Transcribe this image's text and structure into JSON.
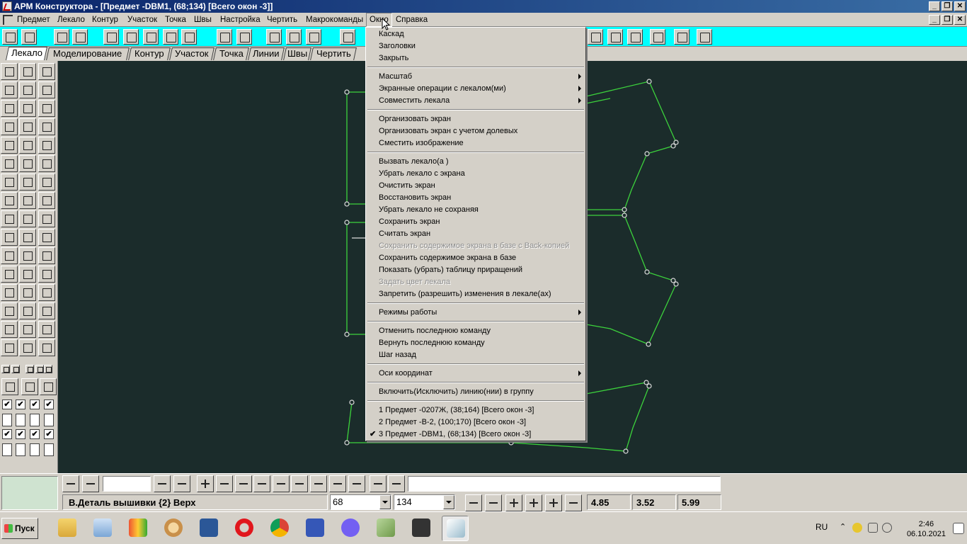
{
  "window": {
    "title": "АРМ Конструктора - [Предмет -DBM1,  (68;134) [Всего окон -3]]"
  },
  "menubar": {
    "items": [
      "Предмет",
      "Лекало",
      "Контур",
      "Участок",
      "Точка",
      "Швы",
      "Настройка",
      "Чертить",
      "Макрокоманды",
      "Окно",
      "Справка"
    ],
    "active": "Окно"
  },
  "tabs": [
    "Лекало",
    "Моделирование",
    "Контур",
    "Участок",
    "Точка",
    "Линии",
    "Швы",
    "Чертить"
  ],
  "active_tab": "Лекало",
  "window_menu": {
    "items": [
      {
        "label": "Каскад"
      },
      {
        "label": "Заголовки"
      },
      {
        "label": "Закрыть"
      },
      {
        "sep": true
      },
      {
        "label": "Масштаб",
        "submenu": true
      },
      {
        "label": "Экранные операции с лекалом(ми)",
        "submenu": true
      },
      {
        "label": "Совместить лекала",
        "submenu": true
      },
      {
        "sep": true
      },
      {
        "label": "Организовать  экран"
      },
      {
        "label": "Организовать экран с учетом долевых"
      },
      {
        "label": "Сместить изображение"
      },
      {
        "sep": true
      },
      {
        "label": "Вызвать лекало(а )"
      },
      {
        "label": "Убрать лекало с экрана"
      },
      {
        "label": "Очистить экран"
      },
      {
        "label": "Восстановить экран"
      },
      {
        "label": "Убрать лекало не сохраняя"
      },
      {
        "label": "Сохранить  экран"
      },
      {
        "label": "Считать экран"
      },
      {
        "label": "Сохранить содержимое экрана в базе с  Back-копией",
        "disabled": true
      },
      {
        "label": "Сохранить содержимое экрана в базе"
      },
      {
        "label": "Показать (убрать) таблицу приращений"
      },
      {
        "label": "Задать цвет лекала",
        "disabled": true
      },
      {
        "label": "Запретить (разрешить) изменения в лекале(ах)"
      },
      {
        "sep": true
      },
      {
        "label": "Режимы работы",
        "submenu": true
      },
      {
        "sep": true
      },
      {
        "label": "Отменить последнюю команду"
      },
      {
        "label": "Вернуть последнюю команду"
      },
      {
        "label": "Шаг назад"
      },
      {
        "sep": true
      },
      {
        "label": "Оси координат",
        "submenu": true
      },
      {
        "sep": true
      },
      {
        "label": "Включить(Исключить) линию(нии) в группу"
      },
      {
        "sep": true
      },
      {
        "label": "1 Предмет -0207Ж,  (38;164) [Всего окон -3]"
      },
      {
        "label": "2 Предмет -В-2,  (100;170) [Всего окон -3]"
      },
      {
        "label": "3 Предмет -DBM1,  (68;134) [Всего окон -3]",
        "checked": true
      }
    ]
  },
  "status": {
    "detail": "В.Деталь вышивки {2} Верх",
    "x_value": "68",
    "y_value": "134",
    "num1": "4.85",
    "num2": "3.52",
    "num3": "5.99"
  },
  "taskbar": {
    "start_label": "Пуск",
    "lang": "RU",
    "time": "2:46",
    "date": "06.10.2021"
  },
  "colors": {
    "canvas": "#1b2c2b",
    "pattern_line": "#3cd23c",
    "toolbar": "#00ffff",
    "title_start": "#0a246a"
  }
}
